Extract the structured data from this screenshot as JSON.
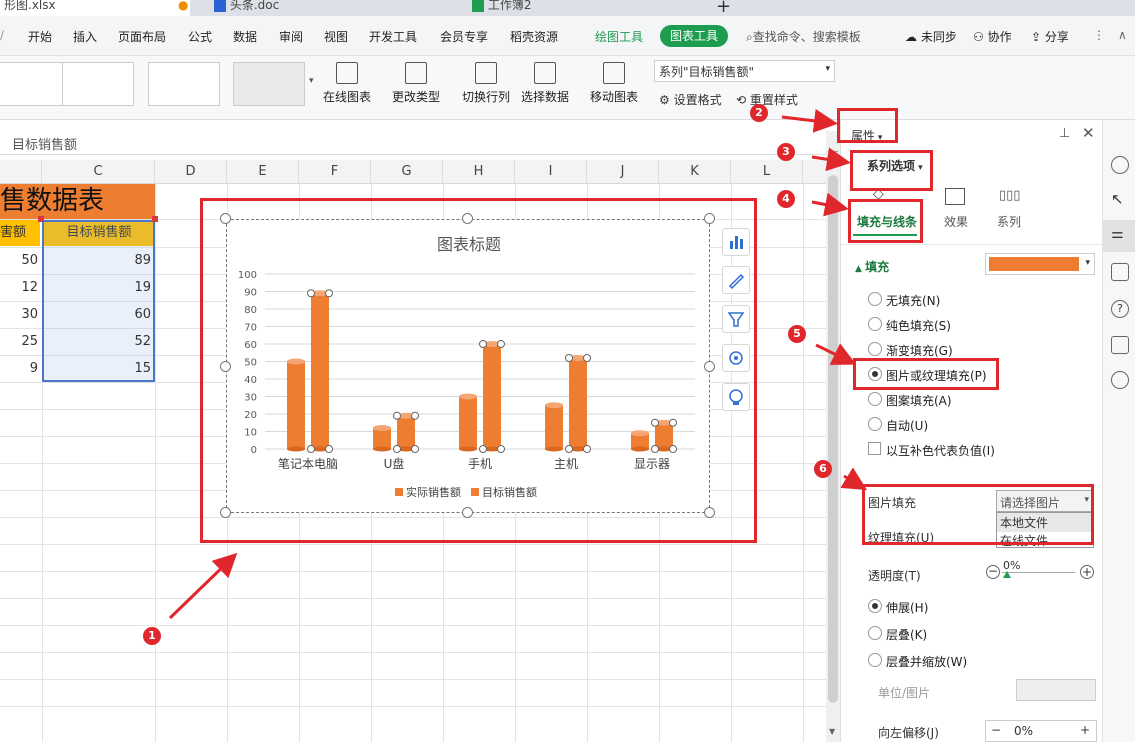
{
  "tabs": [
    {
      "label": "形图.xlsx",
      "active": true
    },
    {
      "label": "头条.doc",
      "active": false
    },
    {
      "label": "工作簿2",
      "active": false
    }
  ],
  "menu": {
    "items": [
      "开始",
      "插入",
      "页面布局",
      "公式",
      "数据",
      "审阅",
      "视图",
      "开发工具",
      "会员专享",
      "稻壳资源"
    ],
    "drawing_tools": "绘图工具",
    "chart_tools": "图表工具",
    "search": "查找命令、搜索模板",
    "unsynced": "未同步",
    "collaborate": "协作",
    "share": "分享"
  },
  "ribbon": {
    "online_chart": "在线图表",
    "change_type": "更改类型",
    "switch_row_col": "切换行列",
    "select_data": "选择数据",
    "move_chart": "移动图表",
    "series_select": "系列\"目标销售额\"",
    "set_format": "设置格式",
    "reset_style": "重置样式"
  },
  "formula": {
    "value": "目标销售额"
  },
  "columns": [
    "C",
    "D",
    "E",
    "F",
    "G",
    "H",
    "I",
    "J",
    "K",
    "L"
  ],
  "sheet": {
    "title": "售数据表",
    "header_b": "害额",
    "header_c": "目标销售额",
    "b_values": [
      50,
      12,
      30,
      25,
      9
    ],
    "c_values": [
      89,
      19,
      60,
      52,
      15
    ]
  },
  "chart_data": {
    "type": "bar",
    "title": "图表标题",
    "categories": [
      "笔记本电脑",
      "U盘",
      "手机",
      "主机",
      "显示器"
    ],
    "series": [
      {
        "name": "实际销售额",
        "values": [
          50,
          12,
          30,
          25,
          9
        ]
      },
      {
        "name": "目标销售额",
        "values": [
          89,
          19,
          60,
          52,
          15
        ]
      }
    ],
    "ylim": [
      0,
      100
    ],
    "yticks": [
      0,
      10,
      20,
      30,
      40,
      50,
      60,
      70,
      80,
      90,
      100
    ],
    "bar_color": "#ed7d31",
    "legend": "bottom"
  },
  "panel": {
    "properties": "属性",
    "series_options": "系列选项",
    "tabs": [
      "填充与线条",
      "效果",
      "系列"
    ],
    "fill_section": "填充",
    "fill_color": "#ed7d31",
    "fill_options": [
      {
        "label": "无填充(N)",
        "checked": false
      },
      {
        "label": "纯色填充(S)",
        "checked": false
      },
      {
        "label": "渐变填充(G)",
        "checked": false
      },
      {
        "label": "图片或纹理填充(P)",
        "checked": true
      },
      {
        "label": "图案填充(A)",
        "checked": false
      },
      {
        "label": "自动(U)",
        "checked": false
      }
    ],
    "invert_label": "以互补色代表负值(I)",
    "picture_fill_label": "图片填充",
    "picture_fill_select": "请选择图片",
    "dropdown_options": [
      "本地文件",
      "在线文件"
    ],
    "texture_label": "纹理填充(U)",
    "transparency_label": "透明度(T)",
    "transparency_value": "0%",
    "stretch_options": [
      {
        "label": "伸展(H)",
        "checked": true
      },
      {
        "label": "层叠(K)",
        "checked": false
      },
      {
        "label": "层叠并缩放(W)",
        "checked": false
      }
    ],
    "unit_label": "单位/图片",
    "offset_left_label": "向左偏移(J)",
    "offset_value": "0%"
  },
  "annotations": [
    "1",
    "2",
    "3",
    "4",
    "5",
    "6"
  ]
}
